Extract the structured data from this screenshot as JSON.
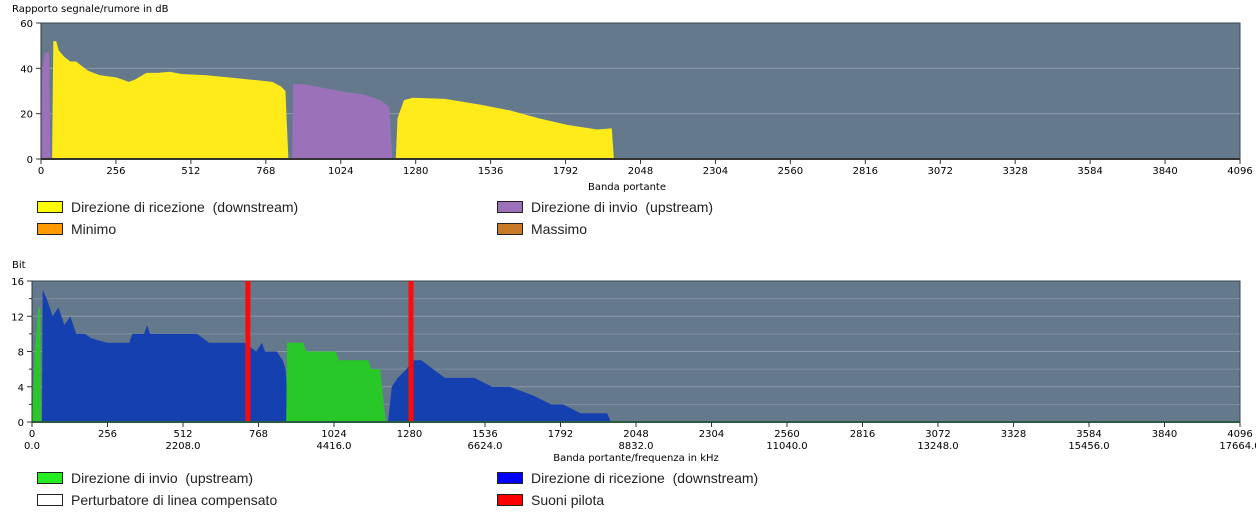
{
  "chart_data": [
    {
      "type": "area",
      "title": "Rapporto segnale/rumore in dB",
      "xlabel": "Banda portante",
      "ylabel": "Rapporto segnale/rumore in dB",
      "xlim": [
        0,
        4096
      ],
      "ylim": [
        0,
        60
      ],
      "xticks": [
        "0",
        "256",
        "512",
        "768",
        "1024",
        "1280",
        "1536",
        "1792",
        "2048",
        "2304",
        "2560",
        "2816",
        "3072",
        "3328",
        "3584",
        "3840",
        "4096"
      ],
      "yticks": [
        "0",
        "20",
        "40",
        "60"
      ],
      "grid": true,
      "series": [
        {
          "name": "Direzione di invio  (upstream)",
          "color": "#9b72b9",
          "points": [
            [
              0,
              0
            ],
            [
              4,
              40
            ],
            [
              14,
              47
            ],
            [
              28,
              47
            ],
            [
              32,
              0
            ]
          ]
        },
        {
          "name": "Direzione di ricezione  (downstream)",
          "color": "#ffea1a",
          "points": [
            [
              38,
              0
            ],
            [
              42,
              52
            ],
            [
              52,
              52
            ],
            [
              60,
              48
            ],
            [
              80,
              45
            ],
            [
              100,
              43
            ],
            [
              120,
              43
            ],
            [
              140,
              41
            ],
            [
              160,
              39
            ],
            [
              200,
              37
            ],
            [
              256,
              36
            ],
            [
              280,
              35
            ],
            [
              300,
              34
            ],
            [
              320,
              35
            ],
            [
              360,
              38
            ],
            [
              400,
              38
            ],
            [
              440,
              38.5
            ],
            [
              480,
              37.5
            ],
            [
              560,
              37
            ],
            [
              640,
              36
            ],
            [
              720,
              35
            ],
            [
              790,
              34
            ],
            [
              820,
              32
            ],
            [
              835,
              30
            ],
            [
              845,
              0
            ]
          ]
        },
        {
          "name": "Direzione di invio  (upstream)",
          "color": "#9b72b9",
          "points": [
            [
              858,
              0
            ],
            [
              861,
              33
            ],
            [
              900,
              33
            ],
            [
              960,
              31.5
            ],
            [
              1040,
              29.5
            ],
            [
              1100,
              28.5
            ],
            [
              1160,
              26
            ],
            [
              1190,
              23
            ],
            [
              1200,
              0
            ]
          ]
        },
        {
          "name": "Direzione di ricezione  (downstream)",
          "color": "#ffea1a",
          "points": [
            [
              1212,
              0
            ],
            [
              1218,
              18
            ],
            [
              1240,
              26
            ],
            [
              1270,
              27
            ],
            [
              1380,
              26.5
            ],
            [
              1500,
              24
            ],
            [
              1600,
              21.5
            ],
            [
              1700,
              18
            ],
            [
              1800,
              15
            ],
            [
              1900,
              13
            ],
            [
              1950,
              13.5
            ],
            [
              1957,
              0
            ]
          ]
        }
      ],
      "legend": {
        "placement": "bottom",
        "items": [
          {
            "label": "Direzione di ricezione  (downstream)",
            "color": "#ffff00"
          },
          {
            "label": "Direzione di invio  (upstream)",
            "color": "#9b72b9"
          },
          {
            "label": "Minimo",
            "color": "#ff9a00"
          },
          {
            "label": "Massimo",
            "color": "#c87a28"
          }
        ]
      }
    },
    {
      "type": "area",
      "title": "Bit",
      "xlabel": "Banda portante/frequenza in kHz",
      "ylabel": "Bit",
      "xlim": [
        0,
        4096
      ],
      "ylim": [
        0,
        16
      ],
      "xticks": [
        "0",
        "256",
        "512",
        "768",
        "1024",
        "1280",
        "1536",
        "1792",
        "2048",
        "2304",
        "2560",
        "2816",
        "3072",
        "3328",
        "3584",
        "3840",
        "4096"
      ],
      "freq_ticks": [
        "0.0",
        "2208.0",
        "4416.0",
        "6624.0",
        "8832.0",
        "11040.0",
        "13248.0",
        "15456.0",
        "17664.0"
      ],
      "yticks": [
        "0",
        "4",
        "8",
        "12",
        "16"
      ],
      "grid": true,
      "series": [
        {
          "name": "Direzione di invio  (upstream)",
          "color": "#28c828",
          "points": [
            [
              0,
              0
            ],
            [
              10,
              8
            ],
            [
              22,
              13
            ],
            [
              28,
              13
            ],
            [
              31,
              0
            ]
          ]
        },
        {
          "name": "Direzione di ricezione  (downstream)",
          "color": "#1540b0",
          "points": [
            [
              34,
              0
            ],
            [
              36,
              15
            ],
            [
              50,
              14
            ],
            [
              70,
              12
            ],
            [
              90,
              13
            ],
            [
              110,
              11
            ],
            [
              130,
              12
            ],
            [
              150,
              10
            ],
            [
              180,
              10
            ],
            [
              200,
              9.5
            ],
            [
              256,
              9
            ],
            [
              330,
              9
            ],
            [
              340,
              10
            ],
            [
              380,
              10
            ],
            [
              390,
              11
            ],
            [
              400,
              10
            ],
            [
              560,
              10
            ],
            [
              600,
              9
            ],
            [
              720,
              9
            ],
            [
              760,
              8
            ],
            [
              780,
              9
            ],
            [
              790,
              8
            ],
            [
              830,
              8
            ],
            [
              850,
              7
            ],
            [
              860,
              6
            ],
            [
              870,
              0
            ]
          ]
        },
        {
          "name": "Direzione di invio  (upstream)",
          "color": "#28c828",
          "points": [
            [
              862,
              0
            ],
            [
              865,
              9
            ],
            [
              920,
              9
            ],
            [
              930,
              8
            ],
            [
              1030,
              8
            ],
            [
              1040,
              7
            ],
            [
              1140,
              7
            ],
            [
              1150,
              6
            ],
            [
              1180,
              6
            ],
            [
              1200,
              0
            ]
          ]
        },
        {
          "name": "Direzione di ricezione  (downstream)",
          "color": "#1540b0",
          "points": [
            [
              1207,
              0
            ],
            [
              1220,
              4
            ],
            [
              1240,
              5
            ],
            [
              1270,
              6
            ],
            [
              1290,
              7
            ],
            [
              1320,
              7
            ],
            [
              1360,
              6
            ],
            [
              1400,
              5
            ],
            [
              1500,
              5
            ],
            [
              1560,
              4
            ],
            [
              1620,
              4
            ],
            [
              1700,
              3
            ],
            [
              1760,
              2
            ],
            [
              1800,
              2
            ],
            [
              1860,
              1
            ],
            [
              1950,
              1
            ],
            [
              1963,
              0
            ]
          ]
        }
      ],
      "pilot_tones": {
        "color": "#ff0a0a",
        "carriers": [
          732,
          1285
        ]
      },
      "legend": {
        "placement": "bottom",
        "items": [
          {
            "label": "Direzione di invio  (upstream)",
            "color": "#22ee22"
          },
          {
            "label": "Direzione di ricezione  (downstream)",
            "color": "#0000ff"
          },
          {
            "label": "Perturbatore di linea compensato",
            "color": "#ffffff"
          },
          {
            "label": "Suoni pilota",
            "color": "#ff0000"
          }
        ]
      }
    }
  ]
}
